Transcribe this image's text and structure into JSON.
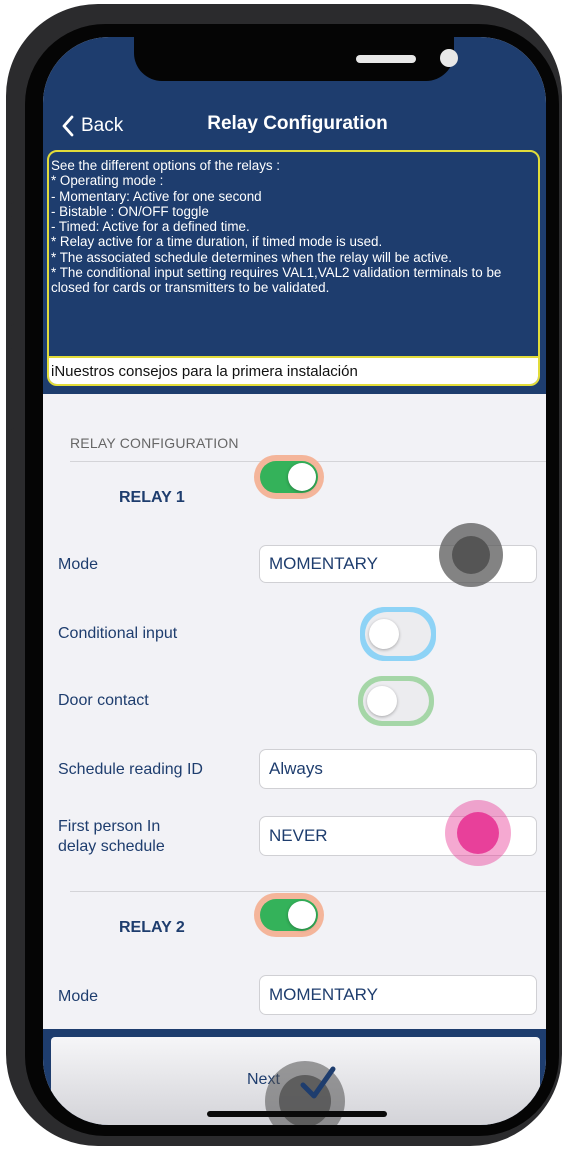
{
  "nav": {
    "back_label": "Back",
    "title": "Relay Configuration"
  },
  "info": {
    "text": "See the different options of the relays :\n* Operating mode :\n - Momentary: Active for one second\n - Bistable : ON/OFF toggle\n - Timed: Active for a defined time.\n* Relay active for a time duration, if timed mode is used.\n* The associated schedule determines when the relay will be active.\n* The conditional input setting requires VAL1,VAL2 validation terminals to be closed for cards or transmitters to be validated.",
    "link": "iNuestros consejos para la primera instalación"
  },
  "section_header": "RELAY CONFIGURATION",
  "relay1": {
    "title": "RELAY 1",
    "enabled": true,
    "mode_label": "Mode",
    "mode_value": "MOMENTARY",
    "conditional_input_label": "Conditional input",
    "conditional_input": false,
    "door_contact_label": "Door contact",
    "door_contact": false,
    "schedule_label": "Schedule reading ID",
    "schedule_value": "Always",
    "first_person_label": "First person In\ndelay schedule",
    "first_person_value": "NEVER"
  },
  "relay2": {
    "title": "RELAY 2",
    "enabled": true,
    "mode_label": "Mode",
    "mode_value": "MOMENTARY"
  },
  "footer": {
    "next_label": "Next"
  },
  "colors": {
    "navy": "#1e3d6e",
    "highlight_border": "#e2dc3a",
    "toggle_on": "#34b25a",
    "ring_orange": "#f4b59a",
    "ring_blue": "#8ed3f6",
    "ring_green": "#a5d6a7",
    "touch_gray": "#555555",
    "touch_pink": "#e8409a"
  }
}
